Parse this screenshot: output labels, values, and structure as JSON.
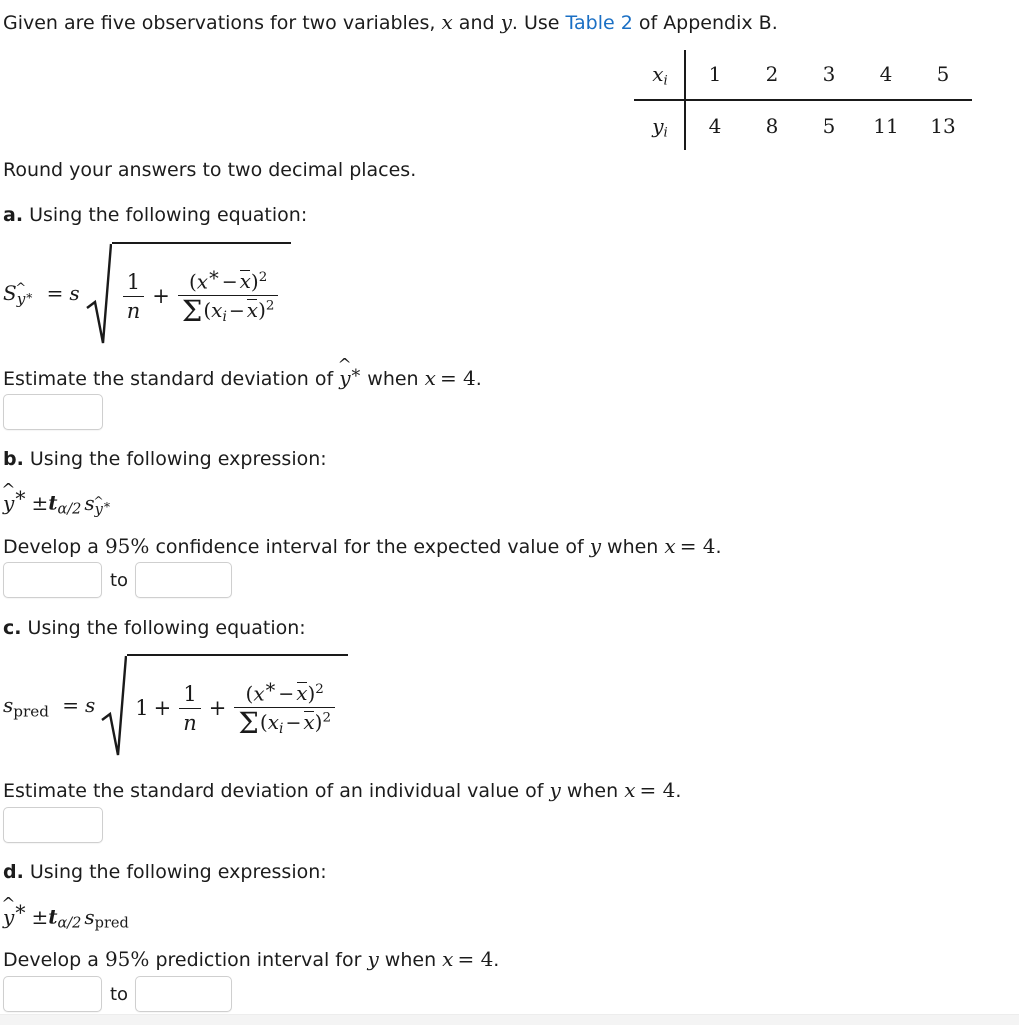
{
  "intro": {
    "text_before_link": "Given are five observations for two variables, ",
    "var_x": "x",
    "text_and": " and ",
    "var_y": "y",
    "text_use": ". Use ",
    "link_label": "Table 2",
    "text_after_link": " of Appendix B.",
    "link_color": "#1a6fc4"
  },
  "observations_table": {
    "row_x_label": "x",
    "row_x_label_sub": "i",
    "row_y_label": "y",
    "row_y_label_sub": "i",
    "x_values": [
      "1",
      "2",
      "3",
      "4",
      "5"
    ],
    "y_values": [
      "4",
      "8",
      "5",
      "11",
      "13"
    ]
  },
  "rounding_note": "Round your answers to two decimal places.",
  "parts": {
    "a": {
      "marker": "a.",
      "intro": "Using the following equation:",
      "formula": {
        "lhs_symbol": "S",
        "lhs_sub_hat": "y",
        "lhs_sub_star": "*",
        "lhs_eq": "=",
        "lhs_s": "s",
        "term_one_num": "1",
        "term_one_den": "n",
        "plus": "+",
        "frac_num": "(x * − x̄)²",
        "frac_den": "Σ(xᵢ − x̄)²"
      },
      "prompt_before": "Estimate the standard deviation of ",
      "prompt_yhat": "y",
      "prompt_star": "*",
      "prompt_when": " when ",
      "prompt_x": "x",
      "prompt_eq_val": "= 4",
      "prompt_end": ".",
      "answer_value": "",
      "answer_placeholder": ""
    },
    "b": {
      "marker": "b.",
      "intro": "Using the following expression:",
      "expression": {
        "yhat": "y",
        "star": "*",
        "plusminus": "±",
        "t": "t",
        "t_sub": "α/2",
        "s": "s",
        "s_sub_hat": "y",
        "s_sub_star": "*"
      },
      "prompt_before": "Develop a ",
      "confidence_level": "95%",
      "prompt_mid": " confidence interval for the expected value of ",
      "prompt_y": "y",
      "prompt_when": " when ",
      "prompt_x": "x",
      "prompt_eq_val": "= 4",
      "prompt_end": ".",
      "to_label": "to",
      "answer_lower": "",
      "answer_upper": ""
    },
    "c": {
      "marker": "c.",
      "intro": "Using the following equation:",
      "formula": {
        "lhs_symbol": "s",
        "lhs_sub": "pred",
        "lhs_eq": "=",
        "lhs_s": "s",
        "leading_one": "1",
        "term_one_num": "1",
        "term_one_den": "n",
        "plus": "+",
        "frac_num": "(x * − x̄)²",
        "frac_den": "Σ(xᵢ − x̄)²"
      },
      "prompt_before": "Estimate the standard deviation of an individual value of ",
      "prompt_y": "y",
      "prompt_when": " when ",
      "prompt_x": "x",
      "prompt_eq_val": "= 4",
      "prompt_end": ".",
      "answer_value": "",
      "answer_placeholder": ""
    },
    "d": {
      "marker": "d.",
      "intro": "Using the following expression:",
      "expression": {
        "yhat": "y",
        "star": "*",
        "plusminus": "±",
        "t": "t",
        "t_sub": "α/2",
        "s": "s",
        "s_sub": "pred"
      },
      "prompt_before": "Develop a ",
      "confidence_level": "95%",
      "prompt_mid": " prediction interval for ",
      "prompt_y": "y",
      "prompt_when": " when ",
      "prompt_x": "x",
      "prompt_eq_val": "= 4",
      "prompt_end": ".",
      "to_label": "to",
      "answer_lower": "",
      "answer_upper": ""
    }
  }
}
